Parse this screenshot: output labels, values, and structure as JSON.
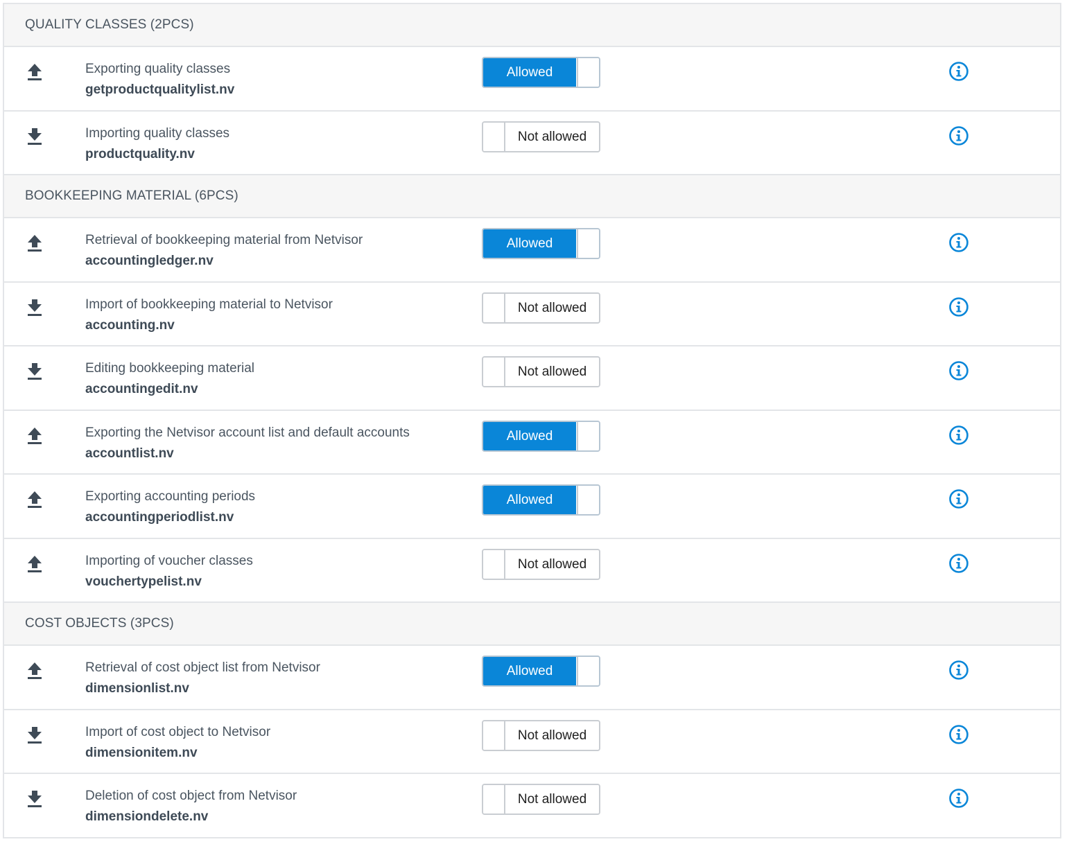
{
  "colors": {
    "accent": "#0a86d8",
    "header_bg": "#f6f6f6",
    "border": "#e3e5e8",
    "text": "#4a5560"
  },
  "sections": [
    {
      "title": "QUALITY CLASSES (2PCS)",
      "rows": [
        {
          "direction": "upload-icon",
          "title": "Exporting quality classes",
          "file": "getproductqualitylist.nv",
          "state": "Allowed",
          "on": true
        },
        {
          "direction": "download-icon",
          "title": "Importing quality classes",
          "file": "productquality.nv",
          "state": "Not allowed",
          "on": false
        }
      ]
    },
    {
      "title": "BOOKKEEPING MATERIAL (6PCS)",
      "rows": [
        {
          "direction": "upload-icon",
          "title": "Retrieval of bookkeeping material from Netvisor",
          "file": "accountingledger.nv",
          "state": "Allowed",
          "on": true
        },
        {
          "direction": "download-icon",
          "title": "Import of bookkeeping material to Netvisor",
          "file": "accounting.nv",
          "state": "Not allowed",
          "on": false
        },
        {
          "direction": "download-icon",
          "title": "Editing bookkeeping material",
          "file": "accountingedit.nv",
          "state": "Not allowed",
          "on": false
        },
        {
          "direction": "upload-icon",
          "title": "Exporting the Netvisor account list and default accounts",
          "file": "accountlist.nv",
          "state": "Allowed",
          "on": true
        },
        {
          "direction": "upload-icon",
          "title": "Exporting accounting periods",
          "file": "accountingperiodlist.nv",
          "state": "Allowed",
          "on": true
        },
        {
          "direction": "upload-icon",
          "title": "Importing of voucher classes",
          "file": "vouchertypelist.nv",
          "state": "Not allowed",
          "on": false
        }
      ]
    },
    {
      "title": "COST OBJECTS (3PCS)",
      "rows": [
        {
          "direction": "upload-icon",
          "title": "Retrieval of cost object list from Netvisor",
          "file": "dimensionlist.nv",
          "state": "Allowed",
          "on": true
        },
        {
          "direction": "download-icon",
          "title": "Import of cost object to Netvisor",
          "file": "dimensionitem.nv",
          "state": "Not allowed",
          "on": false
        },
        {
          "direction": "download-icon",
          "title": "Deletion of cost object from Netvisor",
          "file": "dimensiondelete.nv",
          "state": "Not allowed",
          "on": false
        }
      ]
    }
  ]
}
